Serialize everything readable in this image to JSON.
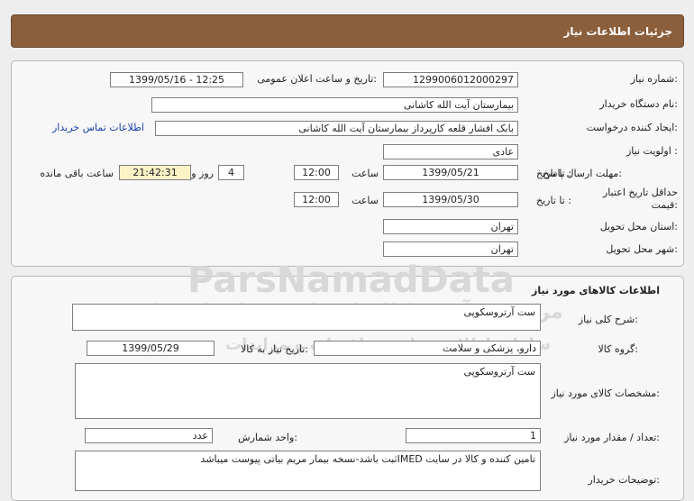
{
  "header": {
    "title": "جزئیات اطلاعات نیاز"
  },
  "need_info": {
    "need_number_label": "شماره نیاز:",
    "need_number": "1299006012000297",
    "announce_label": "تاریخ و ساعت اعلان عمومی:",
    "announce_value": "1399/05/16 - 12:25",
    "buyer_org_label": "نام دستگاه خریدار:",
    "buyer_org": "بیمارستان آیت الله کاشانی",
    "requester_label": "ایجاد کننده درخواست:",
    "requester": "بابک افشار قلعه کارپرداز بیمارستان آیت الله کاشانی",
    "contact_link": "اطلاعات تماس خریدار",
    "priority_label": "اولویت نیاز :",
    "priority": "عادی",
    "deadline_label": "مهلت ارسال پاسخ:",
    "until_date_label": "تا تاریخ :",
    "deadline_date": "1399/05/21",
    "time_label": "ساعت",
    "deadline_time": "12:00",
    "days_value": "4",
    "days_label": "روز و",
    "remaining_time": "21:42:31",
    "remaining_label": "ساعت باقی مانده",
    "validity_label_1": "حداقل تاریخ اعتبار",
    "validity_label_2": "قیمت:",
    "validity_until_label": "تا تاریخ :",
    "validity_date": "1399/05/30",
    "validity_time_label": "ساعت",
    "validity_time": "12:00",
    "province_label": "استان محل تحویل:",
    "province": "تهران",
    "city_label": "شهر محل تحویل:",
    "city": "تهران"
  },
  "goods": {
    "section_title": "اطلاعات کالاهای مورد نیاز",
    "general_desc_label": "شرح کلی نیاز:",
    "general_desc": "ست آرتروسکوپی",
    "goods_group_label": "گروه کالا:",
    "goods_group": "دارو، پزشکی و سلامت",
    "need_date_label": "تاریخ نیاز به کالا:",
    "need_date": "1399/05/29",
    "specs_label": "مشخصات کالای مورد نیاز:",
    "specs": "ست آرتروسکوپی",
    "quantity_label": "تعداد / مقدار مورد نیاز:",
    "quantity": "1",
    "unit_label": "واحد شمارش:",
    "unit": "عدد",
    "notes_label": "توضیحات خریدار:",
    "notes": "تامین کننده و کالا در سایت IMEDثبت باشد-نسخه بیمار مریم بیاتی پیوست میباشد"
  },
  "watermark": {
    "brand": "ParsNamadData",
    "tagline": "مرکز فن آوری اطلاعات پارس نماد داده ها",
    "tagline2": "سامانه اطلاع رسانی مناقصات و مزایدات",
    "phone": "۰۲۱-۸۸۳۴۹۶۷۰-۵"
  }
}
